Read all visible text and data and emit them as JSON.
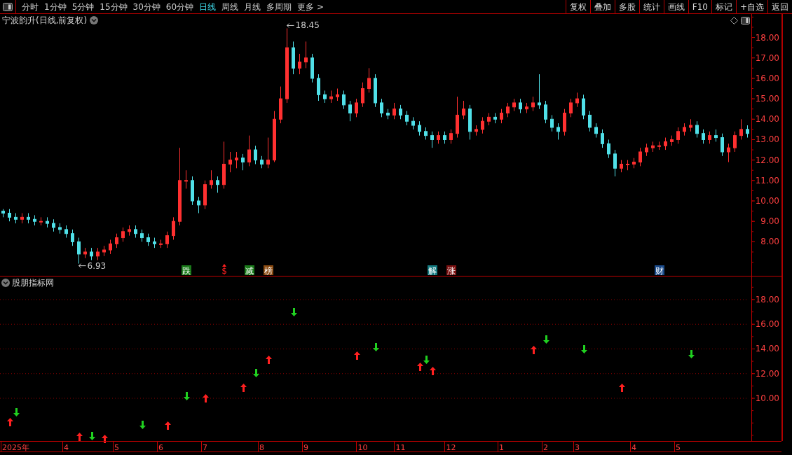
{
  "toolbar": {
    "periods": [
      {
        "label": "分时",
        "selected": false
      },
      {
        "label": "1分钟",
        "selected": false
      },
      {
        "label": "5分钟",
        "selected": false
      },
      {
        "label": "15分钟",
        "selected": false
      },
      {
        "label": "30分钟",
        "selected": false
      },
      {
        "label": "60分钟",
        "selected": false
      },
      {
        "label": "日线",
        "selected": true
      },
      {
        "label": "周线",
        "selected": false
      },
      {
        "label": "月线",
        "selected": false
      },
      {
        "label": "多周期",
        "selected": false
      },
      {
        "label": "更多 >",
        "selected": false
      }
    ],
    "buttons": [
      "复权",
      "叠加",
      "多股",
      "统计",
      "画线",
      "F10",
      "标记",
      "+自选",
      "返回"
    ]
  },
  "price_panel": {
    "title": "宁波韵升(日线,前复权)",
    "high_label": "18.45",
    "low_label": "6.93",
    "events": [
      {
        "label": "跌",
        "kind": "badge",
        "color": "#1a7a1a"
      },
      {
        "label": "$",
        "kind": "mark",
        "color": "#ff2020"
      },
      {
        "label": "减",
        "kind": "badge",
        "color": "#1a7a1a"
      },
      {
        "label": "榜",
        "kind": "badge",
        "color": "#8a4a10"
      },
      {
        "label": "解",
        "kind": "badge",
        "color": "#137a80"
      },
      {
        "label": "涨",
        "kind": "badge",
        "color": "#7a1010"
      },
      {
        "label": "财",
        "kind": "badge",
        "color": "#1a4a8a"
      }
    ],
    "chart_data": {
      "type": "candlestick",
      "ylim": [
        6.3,
        19.15
      ],
      "yticks": [
        {
          "value": 18,
          "label": "18.00"
        },
        {
          "value": 17,
          "label": "17.00"
        },
        {
          "value": 16,
          "label": "16.00"
        },
        {
          "value": 15,
          "label": "15.00"
        },
        {
          "value": 14,
          "label": "14.00"
        },
        {
          "value": 13,
          "label": "13.00"
        },
        {
          "value": 12,
          "label": "12.00"
        },
        {
          "value": 11,
          "label": "11.00"
        },
        {
          "value": 10,
          "label": "10.00"
        },
        {
          "value": 9,
          "label": "9.00"
        },
        {
          "value": 8,
          "label": "8.00"
        }
      ],
      "ohlc": [
        [
          9.5,
          9.6,
          9.2,
          9.4
        ],
        [
          9.4,
          9.6,
          9.0,
          9.2
        ],
        [
          9.2,
          9.4,
          8.9,
          9.1
        ],
        [
          9.1,
          9.4,
          8.9,
          9.2
        ],
        [
          9.2,
          9.4,
          8.9,
          9.1
        ],
        [
          9.1,
          9.3,
          8.8,
          9.0
        ],
        [
          9.0,
          9.2,
          8.8,
          9.0
        ],
        [
          9.0,
          9.2,
          8.7,
          8.9
        ],
        [
          8.9,
          9.1,
          8.5,
          8.7
        ],
        [
          8.7,
          8.9,
          8.4,
          8.6
        ],
        [
          8.6,
          8.8,
          8.2,
          8.4
        ],
        [
          8.4,
          8.6,
          7.8,
          8.0
        ],
        [
          8.0,
          8.2,
          6.93,
          7.4
        ],
        [
          7.4,
          7.7,
          7.2,
          7.5
        ],
        [
          7.5,
          7.7,
          7.1,
          7.3
        ],
        [
          7.3,
          7.7,
          7.1,
          7.5
        ],
        [
          7.5,
          7.8,
          7.3,
          7.6
        ],
        [
          7.6,
          8.1,
          7.4,
          7.9
        ],
        [
          7.9,
          8.4,
          7.7,
          8.2
        ],
        [
          8.2,
          8.7,
          8.0,
          8.5
        ],
        [
          8.5,
          8.8,
          8.3,
          8.6
        ],
        [
          8.6,
          8.8,
          8.2,
          8.4
        ],
        [
          8.4,
          8.6,
          8.0,
          8.2
        ],
        [
          8.2,
          8.4,
          7.8,
          8.0
        ],
        [
          8.0,
          8.2,
          7.7,
          7.9
        ],
        [
          7.9,
          8.1,
          7.7,
          7.9
        ],
        [
          7.9,
          8.5,
          7.7,
          8.3
        ],
        [
          8.3,
          9.2,
          8.1,
          9.0
        ],
        [
          9.0,
          12.6,
          8.8,
          11.0
        ],
        [
          11.0,
          11.5,
          10.6,
          11.0
        ],
        [
          11.0,
          11.2,
          9.8,
          10.0
        ],
        [
          10.0,
          10.2,
          9.4,
          9.8
        ],
        [
          9.8,
          11.0,
          9.6,
          10.8
        ],
        [
          10.8,
          11.5,
          10.6,
          11.0
        ],
        [
          11.0,
          11.2,
          10.4,
          10.8
        ],
        [
          10.8,
          12.9,
          10.6,
          11.8
        ],
        [
          11.8,
          12.4,
          11.4,
          12.0
        ],
        [
          12.0,
          12.4,
          11.6,
          12.1
        ],
        [
          12.1,
          12.3,
          11.5,
          11.9
        ],
        [
          11.9,
          13.2,
          11.7,
          12.5
        ],
        [
          12.5,
          12.7,
          11.8,
          12.0
        ],
        [
          12.0,
          12.2,
          11.6,
          11.8
        ],
        [
          11.8,
          13.1,
          11.6,
          12.0
        ],
        [
          12.0,
          14.4,
          11.9,
          14.0
        ],
        [
          14.0,
          15.6,
          13.8,
          15.0
        ],
        [
          15.0,
          18.45,
          14.8,
          17.5
        ],
        [
          17.5,
          17.8,
          16.2,
          16.5
        ],
        [
          16.5,
          17.2,
          16.2,
          16.8
        ],
        [
          16.8,
          17.8,
          16.5,
          17.0
        ],
        [
          17.0,
          17.2,
          15.8,
          16.0
        ],
        [
          16.0,
          16.2,
          14.9,
          15.2
        ],
        [
          15.2,
          15.4,
          14.8,
          15.0
        ],
        [
          15.0,
          15.4,
          14.8,
          15.1
        ],
        [
          15.1,
          15.5,
          14.9,
          15.2
        ],
        [
          15.2,
          15.4,
          14.5,
          14.7
        ],
        [
          14.7,
          14.9,
          13.9,
          14.3
        ],
        [
          14.3,
          15.0,
          14.1,
          14.8
        ],
        [
          14.8,
          15.8,
          14.6,
          15.5
        ],
        [
          15.5,
          16.5,
          15.3,
          16.0
        ],
        [
          16.0,
          16.2,
          14.6,
          14.8
        ],
        [
          14.8,
          15.0,
          14.1,
          14.3
        ],
        [
          14.3,
          14.5,
          14.0,
          14.2
        ],
        [
          14.2,
          14.8,
          14.0,
          14.5
        ],
        [
          14.5,
          14.7,
          14.0,
          14.2
        ],
        [
          14.2,
          14.4,
          13.7,
          13.9
        ],
        [
          13.9,
          14.1,
          13.5,
          13.7
        ],
        [
          13.7,
          13.9,
          13.2,
          13.4
        ],
        [
          13.4,
          13.6,
          13.0,
          13.2
        ],
        [
          13.2,
          13.4,
          12.6,
          13.0
        ],
        [
          13.0,
          13.4,
          12.8,
          13.2
        ],
        [
          13.2,
          13.4,
          12.8,
          13.0
        ],
        [
          13.0,
          13.5,
          12.8,
          13.3
        ],
        [
          13.3,
          15.1,
          13.1,
          14.2
        ],
        [
          14.2,
          14.9,
          14.0,
          14.5
        ],
        [
          14.5,
          14.7,
          13.0,
          13.4
        ],
        [
          13.4,
          13.7,
          13.2,
          13.5
        ],
        [
          13.5,
          14.1,
          13.3,
          13.9
        ],
        [
          13.9,
          14.3,
          13.7,
          14.1
        ],
        [
          14.1,
          14.3,
          13.8,
          14.0
        ],
        [
          14.0,
          14.5,
          13.8,
          14.3
        ],
        [
          14.3,
          14.8,
          14.1,
          14.6
        ],
        [
          14.6,
          15.0,
          14.4,
          14.8
        ],
        [
          14.8,
          15.0,
          14.3,
          14.5
        ],
        [
          14.5,
          14.8,
          14.3,
          14.6
        ],
        [
          14.6,
          15.1,
          14.4,
          14.8
        ],
        [
          14.8,
          16.2,
          14.5,
          14.7
        ],
        [
          14.7,
          14.9,
          13.8,
          14.0
        ],
        [
          14.0,
          14.2,
          13.4,
          13.6
        ],
        [
          13.6,
          13.8,
          13.0,
          13.4
        ],
        [
          13.4,
          14.5,
          13.2,
          14.3
        ],
        [
          14.3,
          15.0,
          14.1,
          14.8
        ],
        [
          14.8,
          15.3,
          14.6,
          15.0
        ],
        [
          15.0,
          15.2,
          14.0,
          14.2
        ],
        [
          14.2,
          14.4,
          13.4,
          13.6
        ],
        [
          13.6,
          13.8,
          13.1,
          13.3
        ],
        [
          13.3,
          13.5,
          12.6,
          12.8
        ],
        [
          12.8,
          13.0,
          12.1,
          12.3
        ],
        [
          12.3,
          12.5,
          11.2,
          11.6
        ],
        [
          11.6,
          12.0,
          11.4,
          11.8
        ],
        [
          11.8,
          12.0,
          11.5,
          11.8
        ],
        [
          11.8,
          12.1,
          11.6,
          11.9
        ],
        [
          11.9,
          12.6,
          11.7,
          12.4
        ],
        [
          12.4,
          12.8,
          12.2,
          12.6
        ],
        [
          12.6,
          12.9,
          12.4,
          12.7
        ],
        [
          12.7,
          12.9,
          12.5,
          12.7
        ],
        [
          12.7,
          13.1,
          12.5,
          12.9
        ],
        [
          12.9,
          13.2,
          12.7,
          13.0
        ],
        [
          13.0,
          13.6,
          12.8,
          13.4
        ],
        [
          13.4,
          13.8,
          13.2,
          13.6
        ],
        [
          13.6,
          14.0,
          13.4,
          13.7
        ],
        [
          13.7,
          13.9,
          13.1,
          13.3
        ],
        [
          13.3,
          13.5,
          12.8,
          13.0
        ],
        [
          13.0,
          13.4,
          12.8,
          13.2
        ],
        [
          13.2,
          13.5,
          12.9,
          13.1
        ],
        [
          13.1,
          13.3,
          12.2,
          12.4
        ],
        [
          12.4,
          12.8,
          11.9,
          12.6
        ],
        [
          12.6,
          13.4,
          12.4,
          13.2
        ],
        [
          13.2,
          14.0,
          13.0,
          13.5
        ],
        [
          13.5,
          13.7,
          13.1,
          13.3
        ]
      ]
    }
  },
  "indicator_panel": {
    "title": "股朋指标网",
    "chart_data": {
      "type": "scatter",
      "grid": true,
      "ylim": [
        6.54,
        19.87
      ],
      "yticks": [
        {
          "value": 18,
          "label": "18.00"
        },
        {
          "value": 16,
          "label": "16.00"
        },
        {
          "value": 14,
          "label": "14.00"
        },
        {
          "value": 12,
          "label": "12.00"
        },
        {
          "value": 10,
          "label": "10.00"
        }
      ],
      "categories": [
        null,
        null,
        "2025年",
        null,
        null,
        null,
        null,
        null,
        null,
        null,
        "4",
        null,
        null,
        null,
        null,
        null,
        null,
        null,
        "5",
        null,
        null,
        null,
        null,
        null,
        null,
        "6",
        null,
        null,
        null,
        null,
        null,
        null,
        "7",
        null,
        null,
        null,
        null,
        null,
        null,
        null,
        null,
        "8",
        null,
        null,
        null,
        null,
        null,
        null,
        "9",
        null,
        null,
        null,
        null,
        null,
        null,
        null,
        null,
        "10",
        null,
        null,
        null,
        null,
        null,
        "11",
        null,
        null,
        null,
        null,
        null,
        null,
        null,
        "12",
        null,
        null,
        null,
        null,
        null,
        null,
        null,
        "1",
        null,
        null,
        null,
        null,
        null,
        null,
        "2",
        null,
        null,
        null,
        null,
        "3",
        null,
        null,
        null,
        null,
        null,
        null,
        null,
        null,
        "4",
        null,
        null,
        null,
        null,
        null,
        null,
        "5",
        null,
        null,
        null,
        null,
        null,
        null,
        null,
        null,
        null,
        null,
        null
      ],
      "series": [
        {
          "color": "#ff2020",
          "values": [
            null,
            8.07,
            null,
            null,
            null,
            null,
            null,
            null,
            null,
            null,
            null,
            null,
            6.88,
            null,
            null,
            null,
            6.71,
            null,
            null,
            null,
            null,
            null,
            null,
            null,
            null,
            null,
            7.79,
            null,
            null,
            null,
            null,
            null,
            10.0,
            null,
            null,
            null,
            null,
            null,
            10.85,
            null,
            null,
            null,
            13.12,
            null,
            null,
            null,
            null,
            null,
            null,
            null,
            null,
            null,
            null,
            null,
            null,
            null,
            13.46,
            null,
            null,
            null,
            null,
            null,
            null,
            null,
            null,
            null,
            12.55,
            null,
            12.21,
            null,
            null,
            null,
            null,
            null,
            null,
            null,
            null,
            null,
            null,
            null,
            null,
            null,
            null,
            null,
            13.91,
            null,
            null,
            null,
            null,
            null,
            null,
            null,
            null,
            null,
            null,
            null,
            null,
            null,
            10.85,
            null,
            null,
            null,
            null,
            null,
            null,
            null,
            null,
            null,
            null,
            null,
            null,
            null,
            null,
            null,
            null,
            null,
            null,
            null,
            null
          ]
        },
        {
          "color": "#20d020",
          "values": [
            null,
            null,
            8.87,
            null,
            null,
            null,
            null,
            null,
            null,
            null,
            null,
            null,
            null,
            null,
            6.94,
            null,
            null,
            null,
            null,
            null,
            null,
            null,
            7.84,
            null,
            null,
            null,
            null,
            null,
            null,
            10.17,
            null,
            null,
            null,
            null,
            null,
            null,
            null,
            null,
            null,
            null,
            12.04,
            null,
            null,
            null,
            null,
            null,
            16.98,
            null,
            null,
            null,
            null,
            null,
            null,
            null,
            null,
            null,
            null,
            null,
            null,
            14.14,
            null,
            null,
            null,
            null,
            null,
            null,
            null,
            13.12,
            null,
            null,
            null,
            null,
            null,
            null,
            null,
            null,
            null,
            null,
            null,
            null,
            null,
            null,
            null,
            null,
            null,
            null,
            14.77,
            null,
            null,
            null,
            null,
            null,
            13.97,
            null,
            null,
            null,
            null,
            null,
            null,
            null,
            null,
            null,
            null,
            null,
            null,
            null,
            null,
            null,
            null,
            13.57,
            null,
            null,
            null,
            null,
            null,
            null,
            null,
            null,
            null
          ]
        }
      ]
    }
  }
}
